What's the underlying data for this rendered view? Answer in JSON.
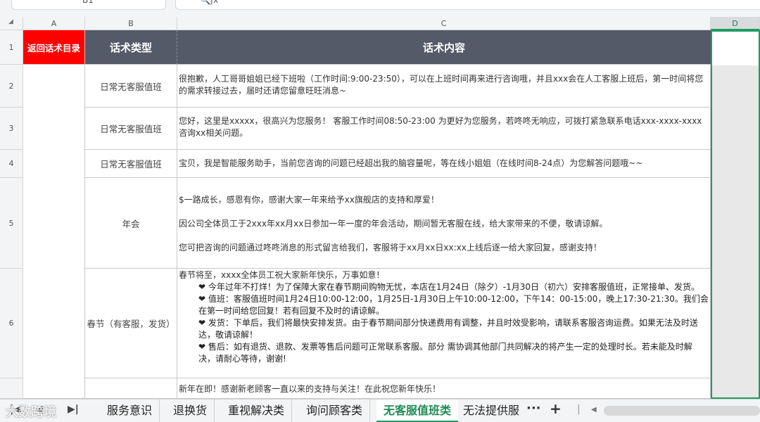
{
  "formula_bar": {
    "name_box": "B1",
    "fx_icon": "search-fx-icon"
  },
  "columns": [
    "A",
    "B",
    "C",
    "D"
  ],
  "select_all_glyph": "◢",
  "rows": [
    "1",
    "2",
    "3",
    "4",
    "5",
    "6"
  ],
  "header": {
    "back_link": "返回话术目录",
    "type_label": "话术类型",
    "content_label": "话术内容"
  },
  "entries": [
    {
      "type": "日常无客服值班",
      "lines": [
        "很抱歉，人工哥哥姐姐已经下班啦（工作时间:9:00-23:50），可以在上班时间再来进行咨询哦，并且xxx会在人工客服上班后，第一时间将您的需求转接过去，届时还请您留意旺旺消息~"
      ]
    },
    {
      "type": "日常无客服值班",
      "lines": [
        "您好，这里是xxxxx，很高兴为您服务！ 客服工作时间08:50-23:00 为更好为您服务，若咚咚无响应，可拨打紧急联系电话xxx-xxxx-xxxx咨询xx相关问题。"
      ]
    },
    {
      "type": "日常无客服值班",
      "lines": [
        "宝贝，我是智能服务助手，当前您咨询的问题已经超出我的脑容量呢，等在线小姐姐（在线时间8-24点）为您解答问题哦~~"
      ]
    },
    {
      "type": "年会",
      "lines": [
        "$一路成长，感恩有你，感谢大家一年来给予xx旗舰店的支持和厚爱！",
        "因公司全体员工于2xxx年xx月xx日参加一年一度的年会活动，期间暂无客服在线，给大家带来的不便，敬请谅解。",
        "您可把咨询的问题通过咚咚消息的形式留言给我们，客服将于xx月xx日xx:xx上线后逐一给大家回复，感谢支持！"
      ]
    },
    {
      "type": "春节（有客服，发货）",
      "intro": "春节将至，xxxx全体员工祝大家新年快乐，万事如意！",
      "bullets": [
        "❤ 今年过年不打烊！为了保障大家在春节期间购物无忧，本店在1月24日（除夕）-1月30日（初六）安排客服值班，正常接单、发货。",
        "❤ 值班：客服值班时间1月24日10:00-12:00，1月25日-1月30日上午10:00-12:00，下午14：00-15:00，晚上17:30-21:30。我们会在第一时间给您回复！若有回复不及时的请谅解。",
        "❤ 发货：下单后，我们将最快安排发货。由于春节期间部分快递费用有调整，并且时效受影响，请联系客服咨询运费。如果无法及时送达，敬请谅解！",
        "❤ 售后：如有退货、退款、发票等售后问题可正常联系客服。部分  需协调其他部门共同解决的将产生一定的处理时长。若未能及时解决，请耐心等待，谢谢!"
      ]
    },
    {
      "type": "",
      "lines": [
        "新年在即！感谢新老顾客一直以来的支持与关注！在此祝您新年快乐！"
      ]
    }
  ],
  "sheet_tabs": {
    "items": [
      "服务意识",
      "退换货",
      "重视解决类",
      "询问顾客类",
      "无客服值班类",
      "无法提供服"
    ],
    "active_index": 4,
    "more_label": "···",
    "add_label": "+"
  },
  "watermark": "大数跨境",
  "colors": {
    "accent": "#1f9d62",
    "header_dark": "#545a68",
    "header_red": "#ff0000"
  }
}
